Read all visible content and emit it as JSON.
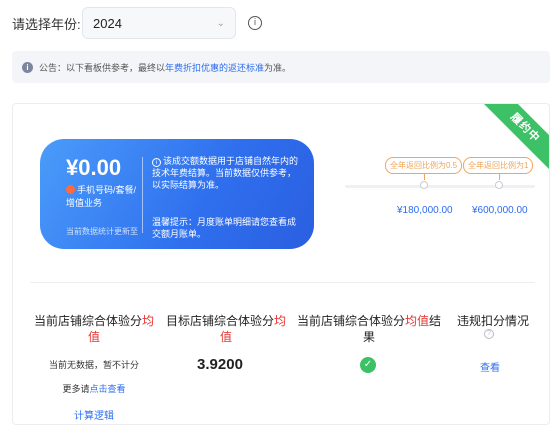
{
  "filter": {
    "year_label": "请选择年份:",
    "year_value": "2024",
    "year_options_visible": [
      "2024"
    ]
  },
  "notice": {
    "prefix": "公告：以下看板供参考，最终以",
    "highlight": "年费折扣优惠的返还标准",
    "suffix": "为准。"
  },
  "panel": {
    "status_ribbon": "履约中",
    "card": {
      "amount": "¥0.00",
      "business_type": "手机号码/套餐/增值业务",
      "stat_time": "当前数据统计更新至",
      "description": "该成交额数据用于店铺自然年内的技术年费结算。当前数据仅供参考，以实际结算为准。",
      "tip": "温馨提示：月度账单明细请您查看成交额月账单。"
    },
    "milestones": [
      {
        "tag": "全年返回比例为0.5",
        "amount": "¥180,000.00"
      },
      {
        "tag": "全年返回比例为1",
        "amount": "¥600,000.00"
      }
    ],
    "metrics": [
      {
        "title_pre": "当前店铺综合体验分",
        "title_red": "均值",
        "title_post": "",
        "value_line1": "当前无数据，暂不计分",
        "value_line2_pre": "更多请",
        "value_line2_link": "点击查看",
        "extra_link": "计算逻辑"
      },
      {
        "title_pre": "目标店铺综合体验分",
        "title_red": "均值",
        "title_post": "",
        "value": "3.9200"
      },
      {
        "title_pre": "当前店铺综合体验分",
        "title_red": "均值",
        "title_post": "结果",
        "status": "passed"
      },
      {
        "title_pre": "违规扣分情况",
        "title_red": "",
        "title_post": "",
        "link": "查看"
      }
    ]
  },
  "colors": {
    "accent": "#2d6cf0",
    "warning": "#e5322e",
    "success": "#3dc166",
    "milestone": "#f0a55b"
  }
}
